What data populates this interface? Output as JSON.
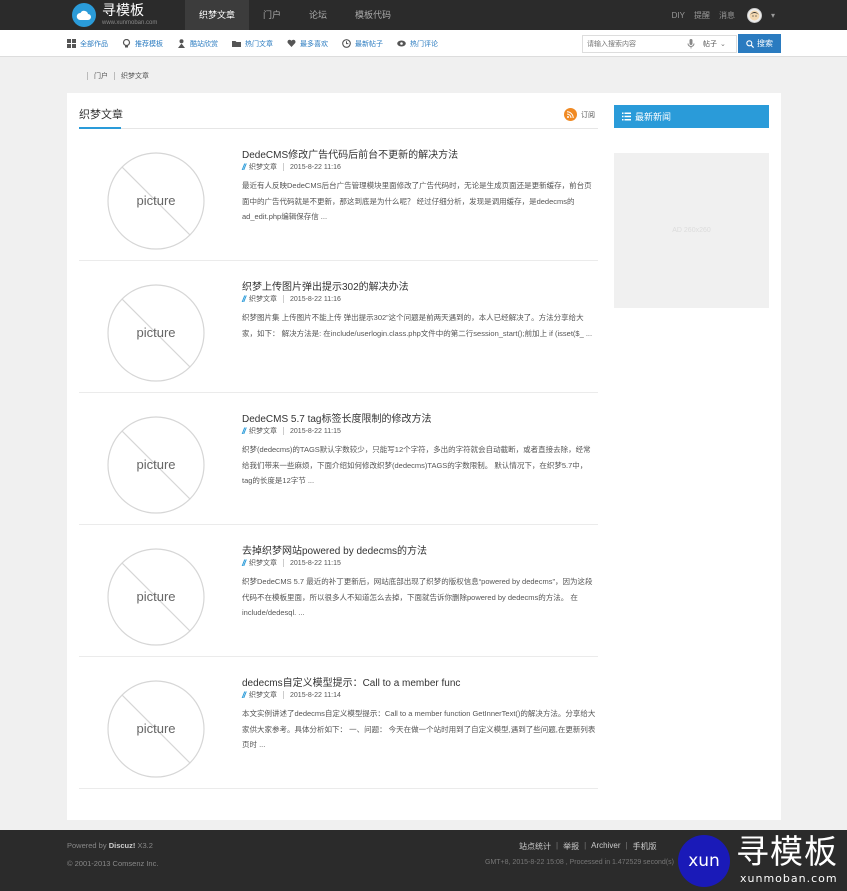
{
  "topbar": {
    "logo_title": "寻模板",
    "logo_subtitle": "www.xunmoban.com",
    "nav": [
      "织梦文章",
      "门户",
      "论坛",
      "模板代码"
    ],
    "active_nav": "织梦文章",
    "right_links": [
      "DIY",
      "提醒",
      "消息"
    ]
  },
  "subnav": {
    "items": [
      {
        "label": "全部作品",
        "icon": "grid-icon"
      },
      {
        "label": "推荐模板",
        "icon": "bulb-icon"
      },
      {
        "label": "酷站欣赏",
        "icon": "person-icon"
      },
      {
        "label": "热门文章",
        "icon": "folder-icon"
      },
      {
        "label": "最多喜欢",
        "icon": "heart-icon"
      },
      {
        "label": "最新帖子",
        "icon": "clock-icon"
      },
      {
        "label": "热门评论",
        "icon": "eye-icon"
      }
    ],
    "search_placeholder": "请输入搜索内容",
    "search_type": "帖子",
    "search_button": "搜索"
  },
  "breadcrumb": [
    "门户",
    "织梦文章"
  ],
  "section": {
    "title": "织梦文章",
    "subscribe": "订阅"
  },
  "thumb_label": "picture",
  "articles": [
    {
      "title": "DedeCMS修改广告代码后前台不更新的解决方法",
      "category": "织梦文章",
      "date": "2015-8-22 11:16",
      "summary": "最近有人反映DedeCMS后台广告管理模块里面修改了广告代码时，无论是生成页面还是更新缓存，前台页面中的广告代码就是不更新，那这到底是为什么呢？ 经过仔细分析，发现是调用缓存，是dedecms的ad_edit.php编辑保存信 ..."
    },
    {
      "title": "织梦上传图片弹出提示302的解决办法",
      "category": "织梦文章",
      "date": "2015-8-22 11:16",
      "summary": "织梦图片集 上传图片不能上传 弹出提示302”这个问题是前两天遇到的，本人已经解决了。方法分享给大家，如下： 解决方法是: 在include/userlogin.class.php文件中的第二行session_start();前加上 if (isset($_ ..."
    },
    {
      "title": "DedeCMS 5.7 tag标签长度限制的修改方法",
      "category": "织梦文章",
      "date": "2015-8-22 11:15",
      "summary": "织梦(dedecms)的TAGS默认字数较少，只能写12个字符，多出的字符就会自动截断，或者直接去除，经常给我们带来一些麻烦，下面介绍如何修改织梦(dedecms)TAGS的字数限制。 默认情况下，在织梦5.7中，tag的长度是12字节 ..."
    },
    {
      "title": "去掉织梦网站powered by dedecms的方法",
      "category": "织梦文章",
      "date": "2015-8-22 11:15",
      "summary": "织梦DedeCMS 5.7 最近的补丁更新后，网站底部出现了织梦的版权信息“powered by dedecms”，因为这段代码不在模板里面，所以很多人不知道怎么去掉，下面就告诉你删除powered by dedecms的方法。 在include/dedesql. ..."
    },
    {
      "title": "dedecms自定义模型提示：Call to a member func",
      "category": "织梦文章",
      "date": "2015-8-22 11:14",
      "summary": "本文实例讲述了dedecms自定义模型提示：Call to a member function GetInnerText()的解决方法。分享给大家供大家参考。具体分析如下： 一、问题： 今天在做一个站时用到了自定义模型,遇到了些问题,在更新列表页时 ..."
    }
  ],
  "sidebar": {
    "title": "最新新闻",
    "ad_text": "AD 260x260"
  },
  "footer": {
    "powered_prefix": "Powered by ",
    "powered_brand": "Discuz!",
    "powered_version": " X3.2",
    "copyright": "© 2001-2013 Comsenz Inc.",
    "links": [
      "站点统计",
      "举报",
      "Archiver",
      "手机版"
    ],
    "stat": "GMT+8, 2015-8-22 15:08 , Processed in 1.472529 second(s)"
  },
  "watermark": {
    "badge": "xun",
    "text": "寻模板",
    "url": "xunmoban.com"
  },
  "colors": {
    "accent": "#2a9bd9",
    "link": "#2a7bc0",
    "rss": "#f08a24",
    "topbar": "#2b2b2b"
  }
}
